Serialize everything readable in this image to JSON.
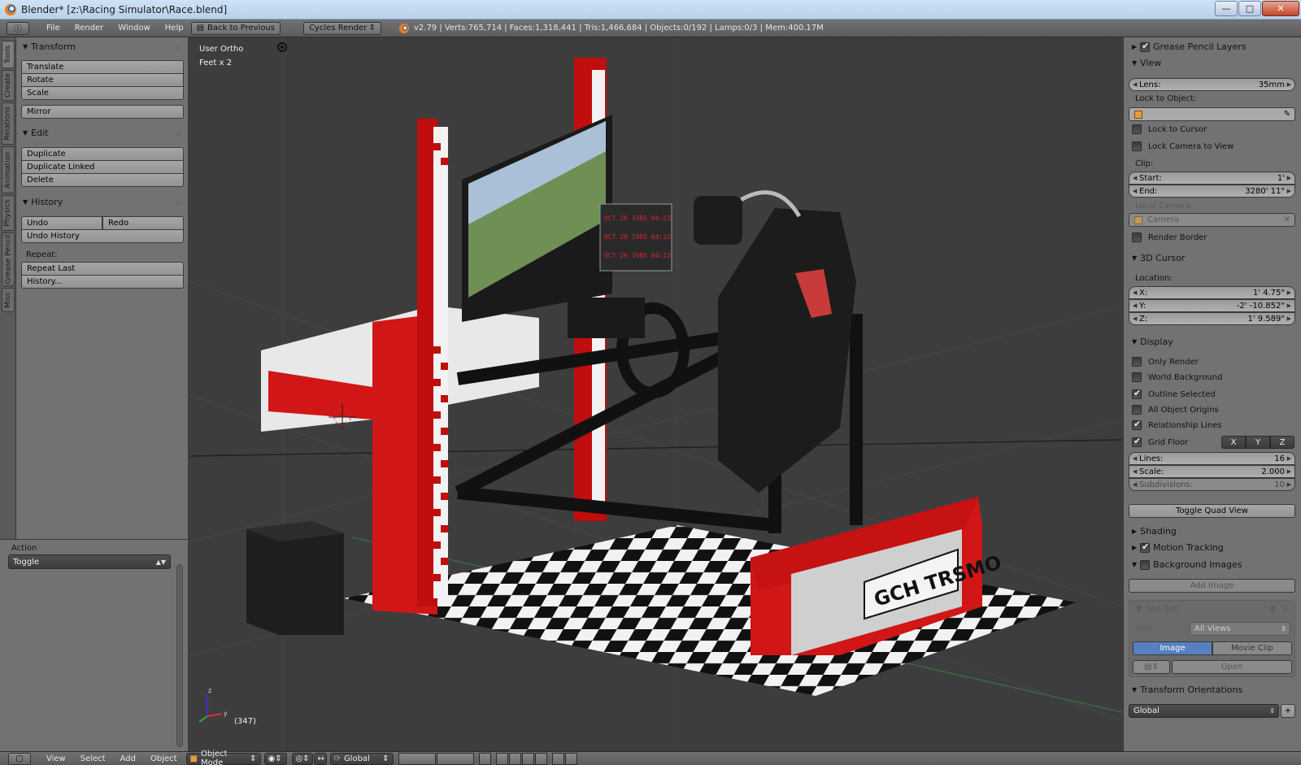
{
  "window": {
    "title": "Blender* [z:\\Racing Simulator\\Race.blend]"
  },
  "infobar": {
    "menus": [
      "File",
      "Render",
      "Window",
      "Help"
    ],
    "back_button": "Back to Previous",
    "render_engine": "Cycles Render",
    "stats": "v2.79 | Verts:765,714 | Faces:1,318,441 | Tris:1,466,684 | Objects:0/192 | Lamps:0/3 | Mem:400.17M"
  },
  "tabs": [
    "Tools",
    "Create",
    "Relations",
    "Animation",
    "Physics",
    "Grease Pencil",
    "Misc"
  ],
  "toolshelf": {
    "transform": {
      "title": "Transform",
      "buttons": [
        "Translate",
        "Rotate",
        "Scale",
        "Mirror"
      ]
    },
    "edit": {
      "title": "Edit",
      "buttons": [
        "Duplicate",
        "Duplicate Linked",
        "Delete"
      ]
    },
    "history": {
      "title": "History",
      "undo": "Undo",
      "redo": "Redo",
      "undo_history": "Undo History",
      "repeat_label": "Repeat:",
      "repeat_last": "Repeat Last",
      "history_btn": "History..."
    }
  },
  "operator": {
    "label": "Action",
    "value": "Toggle"
  },
  "viewport": {
    "view_name": "User Ortho",
    "units": "Feet x 2",
    "frame": "(347)",
    "plate": "GCH TRSMO"
  },
  "npanel": {
    "grease_pencil": "Grease Pencil Layers",
    "view": {
      "title": "View",
      "lens_label": "Lens:",
      "lens_value": "35mm",
      "lock_object_label": "Lock to Object:",
      "lock_cursor": "Lock to Cursor",
      "lock_camera": "Lock Camera to View",
      "clip_label": "Clip:",
      "start_label": "Start:",
      "start_value": "1'",
      "end_label": "End:",
      "end_value": "3280' 11\"",
      "local_camera_label": "Local Camera:",
      "camera_value": "Camera",
      "render_border": "Render Border"
    },
    "cursor": {
      "title": "3D Cursor",
      "location_label": "Location:",
      "x_label": "X:",
      "x_value": "1' 4.75\"",
      "y_label": "Y:",
      "y_value": "-2' -10.852\"",
      "z_label": "Z:",
      "z_value": "1' 9.589\""
    },
    "display": {
      "title": "Display",
      "only_render": "Only Render",
      "world_background": "World Background",
      "outline_selected": "Outline Selected",
      "all_object_origins": "All Object Origins",
      "relationship_lines": "Relationship Lines",
      "grid_floor": "Grid Floor",
      "axes": [
        "X",
        "Y",
        "Z"
      ],
      "lines_label": "Lines:",
      "lines_value": "16",
      "scale_label": "Scale:",
      "scale_value": "2.000",
      "subdiv_label": "Subdivisions:",
      "subdiv_value": "10",
      "toggle_quad": "Toggle Quad View"
    },
    "shading": "Shading",
    "motion_tracking": "Motion Tracking",
    "background_images": {
      "title": "Background Images",
      "add_image": "Add Image",
      "not_set": "Not Set",
      "axis_label": "Axis:",
      "axis_value": "All Views",
      "image_tab": "Image",
      "movie_tab": "Movie Clip",
      "open": "Open"
    },
    "transform_orientations": {
      "title": "Transform Orientations",
      "value": "Global"
    }
  },
  "bottombar": {
    "menus": [
      "View",
      "Select",
      "Add",
      "Object"
    ],
    "mode": "Object Mode",
    "orientation": "Global"
  }
}
